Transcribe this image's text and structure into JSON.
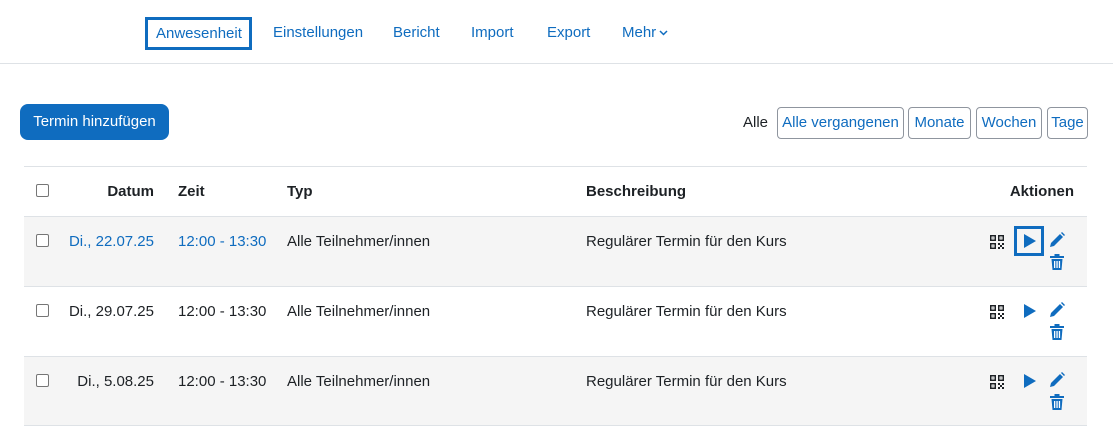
{
  "nav": {
    "tabs": [
      {
        "label": "Anwesenheit",
        "active": true
      },
      {
        "label": "Einstellungen"
      },
      {
        "label": "Bericht"
      },
      {
        "label": "Import"
      },
      {
        "label": "Export"
      },
      {
        "label": "Mehr"
      }
    ],
    "more_icon": "chevron-down-icon"
  },
  "toolbar": {
    "add_label": "Termin hinzufügen",
    "filter_all": "Alle",
    "filters": [
      "Alle vergangenen",
      "Monate",
      "Wochen",
      "Tage"
    ]
  },
  "table": {
    "headers": {
      "date": "Datum",
      "time": "Zeit",
      "type": "Typ",
      "description": "Beschreibung",
      "actions": "Aktionen"
    },
    "rows": [
      {
        "date": "Di., 22.07.25",
        "time": "12:00 - 13:30",
        "type": "Alle Teilnehmer/innen",
        "description": "Regulärer Termin für den Kurs",
        "linked": true
      },
      {
        "date": "Di., 29.07.25",
        "time": "12:00 - 13:30",
        "type": "Alle Teilnehmer/innen",
        "description": "Regulärer Termin für den Kurs",
        "linked": false
      },
      {
        "date": "Di., 5.08.25",
        "time": "12:00 - 13:30",
        "type": "Alle Teilnehmer/innen",
        "description": "Regulärer Termin für den Kurs",
        "linked": false
      }
    ],
    "action_icons": [
      "qr-code-icon",
      "play-icon",
      "pencil-icon",
      "trash-icon"
    ]
  },
  "colors": {
    "accent": "#0f6cbf",
    "row_stripe": "#f5f5f5",
    "border": "#dee2e6",
    "text": "#1d2125"
  }
}
